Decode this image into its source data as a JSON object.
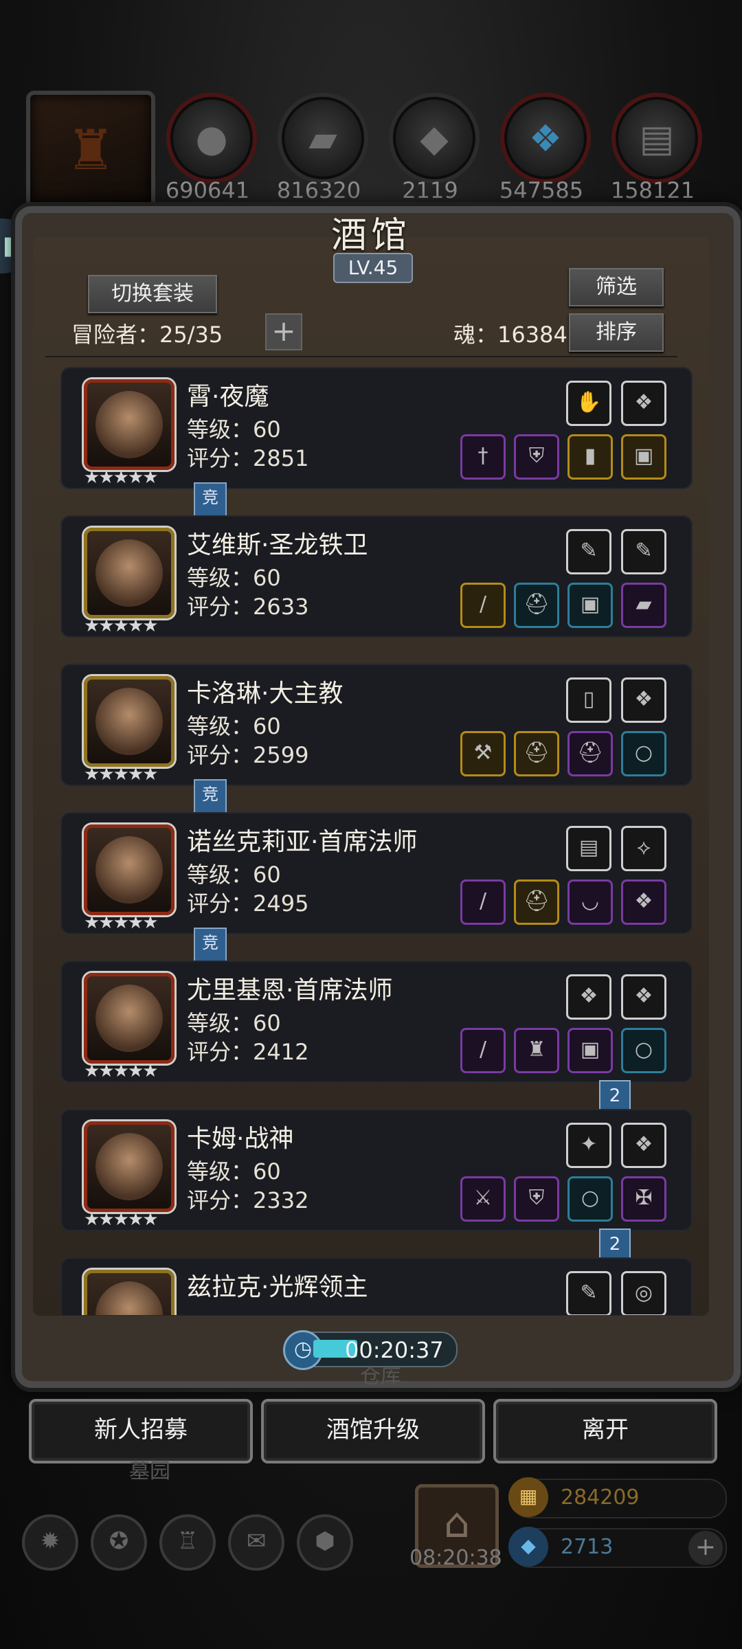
{
  "resources": [
    {
      "icon": "meat-icon",
      "value": "690641"
    },
    {
      "icon": "wood-icon",
      "value": "816320"
    },
    {
      "icon": "stone-icon",
      "value": "2119"
    },
    {
      "icon": "crystal-icon",
      "value": "547585"
    },
    {
      "icon": "iron-icon",
      "value": "158121"
    }
  ],
  "tavern": {
    "title": "酒馆",
    "level": "LV.45",
    "switch_outfit": "切换套装",
    "filter": "筛选",
    "adventurers": "冒险者：25/35",
    "souls": "魂：16384",
    "sort": "排序"
  },
  "heroes": [
    {
      "name": "霄·夜魔",
      "level": "等级：60",
      "score": "评分：2851",
      "stars": "★★★★★",
      "frame": "red",
      "arena": "竞",
      "equip_top": [
        "white",
        "white"
      ],
      "equip_bottom": [
        "purple",
        "purple",
        "gold",
        "gold"
      ]
    },
    {
      "name": "艾维斯·圣龙铁卫",
      "level": "等级：60",
      "score": "评分：2633",
      "stars": "★★★★★",
      "frame": "gold",
      "equip_top": [
        "white",
        "white"
      ],
      "equip_bottom": [
        "gold",
        "blue",
        "blue",
        "purple"
      ]
    },
    {
      "name": "卡洛琳·大主教",
      "level": "等级：60",
      "score": "评分：2599",
      "stars": "★★★★★",
      "frame": "gold",
      "arena": "竞",
      "equip_top": [
        "white",
        "white"
      ],
      "equip_bottom": [
        "gold",
        "gold",
        "purple",
        "blue"
      ]
    },
    {
      "name": "诺丝克莉亚·首席法师",
      "level": "等级：60",
      "score": "评分：2495",
      "stars": "★★★★★",
      "frame": "red",
      "arena": "竞",
      "equip_top": [
        "white",
        "white"
      ],
      "equip_bottom": [
        "purple",
        "gold",
        "purple",
        "purple"
      ]
    },
    {
      "name": "尤里基恩·首席法师",
      "level": "等级：60",
      "score": "评分：2412",
      "stars": "★★★★★",
      "frame": "red",
      "badge": "2",
      "equip_top": [
        "white",
        "white"
      ],
      "equip_bottom": [
        "purple",
        "purple",
        "purple",
        "blue"
      ]
    },
    {
      "name": "卡姆·战神",
      "level": "等级：60",
      "score": "评分：2332",
      "stars": "★★★★★",
      "frame": "red",
      "badge": "2",
      "equip_top": [
        "white",
        "white"
      ],
      "equip_bottom": [
        "purple",
        "purple",
        "blue",
        "purple"
      ]
    },
    {
      "name": "兹拉克·光辉领主",
      "frame": "gold",
      "equip_top": [
        "white",
        "white"
      ]
    }
  ],
  "timer": "00:20:37",
  "buttons": {
    "recruit": "新人招募",
    "upgrade": "酒馆升级",
    "leave": "离开"
  },
  "background": {
    "warehouse": "仓库",
    "cemetery": "墓园",
    "gift_timer": "08:20:38",
    "gold": "284209",
    "gems": "2713"
  }
}
